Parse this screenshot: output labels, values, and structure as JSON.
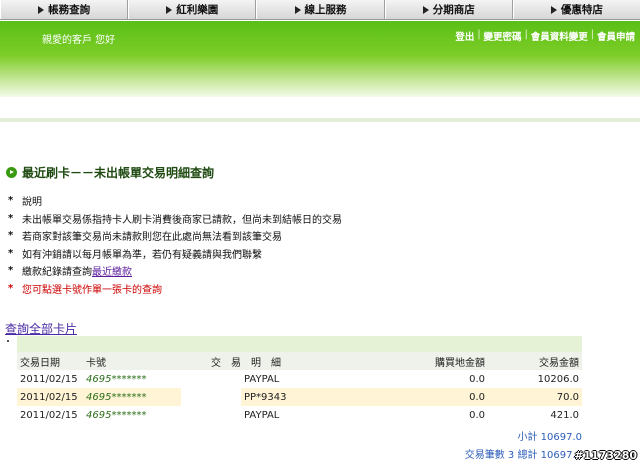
{
  "nav": {
    "tabs": [
      {
        "label": "帳務查詢"
      },
      {
        "label": "紅利樂園"
      },
      {
        "label": "線上服務"
      },
      {
        "label": "分期商店"
      },
      {
        "label": "優惠特店"
      }
    ]
  },
  "banner": {
    "greeting": "親愛的客戶 您好",
    "menu": [
      "登出",
      "變更密碼",
      "會員資料變更",
      "會員申請"
    ]
  },
  "page": {
    "title": "最近刷卡－－未出帳單交易明細查詢"
  },
  "notes": [
    {
      "text": "說明"
    },
    {
      "text": "未出帳單交易係指持卡人刷卡消費後商家已請款，但尚未到結帳日的交易"
    },
    {
      "text": "若商家對該筆交易尚未請款則您在此處尚無法看到該筆交易"
    },
    {
      "text": "如有沖銷請以每月帳單為準，若仍有疑義請與我們聯繫"
    },
    {
      "text": "繳款紀錄請查詢",
      "link": "最近繳款"
    },
    {
      "text": "您可點選卡號作單一張卡的查詢"
    }
  ],
  "query_all_link": "查詢全部卡片",
  "table": {
    "headers": {
      "date": "交易日期",
      "card": "卡號",
      "detail": "交　易　明　細",
      "foreign": "購買地金額",
      "amount": "交易金額"
    },
    "rows": [
      {
        "date": "2011/02/15",
        "card": "4695*******",
        "merchant": "PAYPAL",
        "foreign": "0.0",
        "amount": "10206.0"
      },
      {
        "date": "2011/02/15",
        "card": "4695*******",
        "merchant": "PP*9343",
        "foreign": "0.0",
        "amount": "70.0"
      },
      {
        "date": "2011/02/15",
        "card": "4695*******",
        "merchant": "PAYPAL",
        "foreign": "0.0",
        "amount": "421.0"
      }
    ]
  },
  "totals": {
    "subtotal_label": "小計",
    "subtotal_value": "10697.0",
    "count_label": "交易筆數",
    "count_value": "3",
    "total_label": "總計",
    "total_value": "10697.0"
  },
  "watermark": "#1173280"
}
